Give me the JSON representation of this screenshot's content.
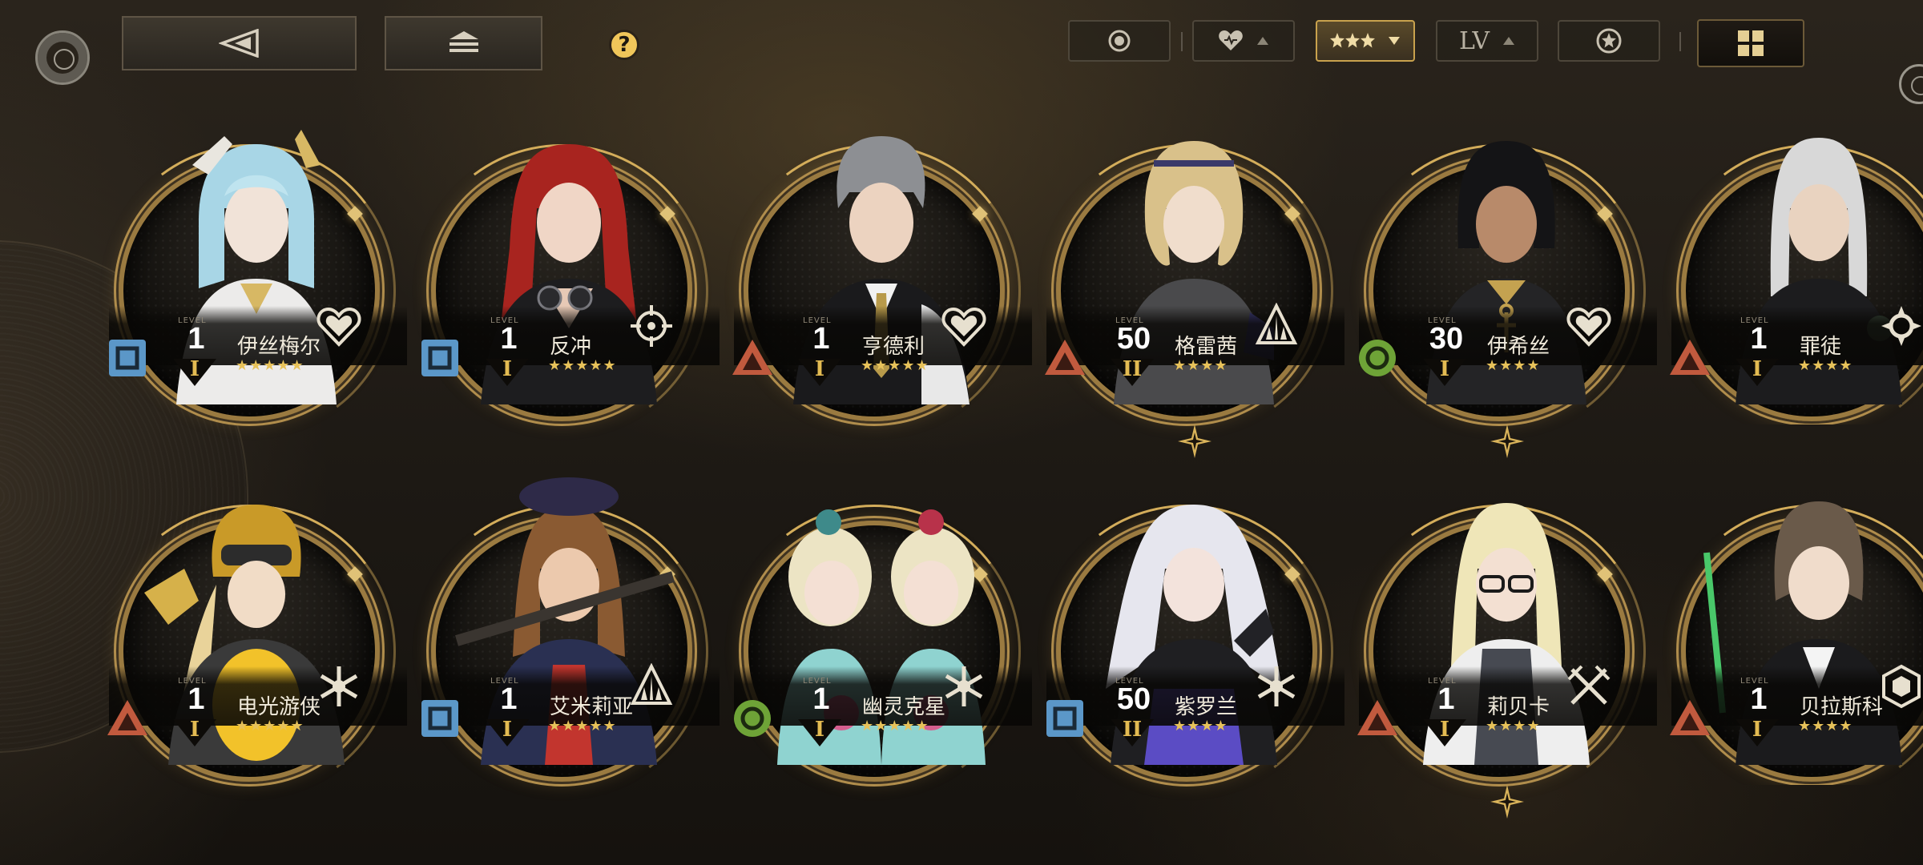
{
  "header": {
    "back_icon": "back-triangle-icon",
    "home_icon": "home-stack-icon",
    "help_label": "?"
  },
  "filters": {
    "attribute_icon": "attribute-circle-icon",
    "affinity_icon": "heart-icon",
    "rarity_icon": "triple-star-icon",
    "level_label": "LV",
    "favorite_icon": "star-medal-icon",
    "active_filter": "rarity",
    "view_mode_icon": "grid-icon"
  },
  "colors": {
    "accent_gold": "#c9a24d",
    "star_gold": "#e7c25a",
    "attr_blue": "#5b97c8",
    "attr_red": "#c15a3e",
    "attr_green": "#6ea337"
  },
  "characters": [
    {
      "name": "伊丝梅尔",
      "level": "1",
      "level_label": "LEVEL",
      "rank": "I",
      "stars": "★★★★★",
      "star_count": 5,
      "attribute": "square",
      "role_icon": "heart-shield-icon"
    },
    {
      "name": "反冲",
      "level": "1",
      "level_label": "LEVEL",
      "rank": "I",
      "stars": "★★★★★",
      "star_count": 5,
      "attribute": "square",
      "role_icon": "crosshair-icon"
    },
    {
      "name": "亨德利",
      "level": "1",
      "level_label": "LEVEL",
      "rank": "I",
      "stars": "★★★★★",
      "star_count": 5,
      "attribute": "triangle",
      "role_icon": "heart-shield-icon"
    },
    {
      "name": "格雷茜",
      "level": "50",
      "level_label": "LEVEL",
      "rank": "II",
      "stars": "★★★★",
      "star_count": 4,
      "attribute": "triangle",
      "role_icon": "spike-icon"
    },
    {
      "name": "伊希丝",
      "level": "30",
      "level_label": "LEVEL",
      "rank": "I",
      "stars": "★★★★",
      "star_count": 4,
      "attribute": "circle",
      "role_icon": "heart-shield-icon"
    },
    {
      "name": "罪徒",
      "level": "1",
      "level_label": "LEVEL",
      "rank": "I",
      "stars": "★★★★",
      "star_count": 4,
      "attribute": "triangle",
      "role_icon": "gear-burst-icon"
    },
    {
      "name": "电光游侠",
      "level": "1",
      "level_label": "LEVEL",
      "rank": "I",
      "stars": "★★★★★",
      "star_count": 5,
      "attribute": "triangle",
      "role_icon": "snowflake-icon"
    },
    {
      "name": "艾米莉亚",
      "level": "1",
      "level_label": "LEVEL",
      "rank": "I",
      "stars": "★★★★★",
      "star_count": 5,
      "attribute": "square",
      "role_icon": "spike-icon"
    },
    {
      "name": "幽灵克星",
      "level": "1",
      "level_label": "LEVEL",
      "rank": "I",
      "stars": "★★★★★",
      "star_count": 5,
      "attribute": "circle",
      "role_icon": "snowflake-icon"
    },
    {
      "name": "紫罗兰",
      "level": "50",
      "level_label": "LEVEL",
      "rank": "II",
      "stars": "★★★★",
      "star_count": 4,
      "attribute": "square",
      "role_icon": "snowflake-icon"
    },
    {
      "name": "莉贝卡",
      "level": "1",
      "level_label": "LEVEL",
      "rank": "I",
      "stars": "★★★★",
      "star_count": 4,
      "attribute": "triangle",
      "role_icon": "crossed-swords-icon"
    },
    {
      "name": "贝拉斯科",
      "level": "1",
      "level_label": "LEVEL",
      "rank": "I",
      "stars": "★★★★",
      "star_count": 4,
      "attribute": "triangle",
      "role_icon": "hexagon-icon"
    }
  ]
}
